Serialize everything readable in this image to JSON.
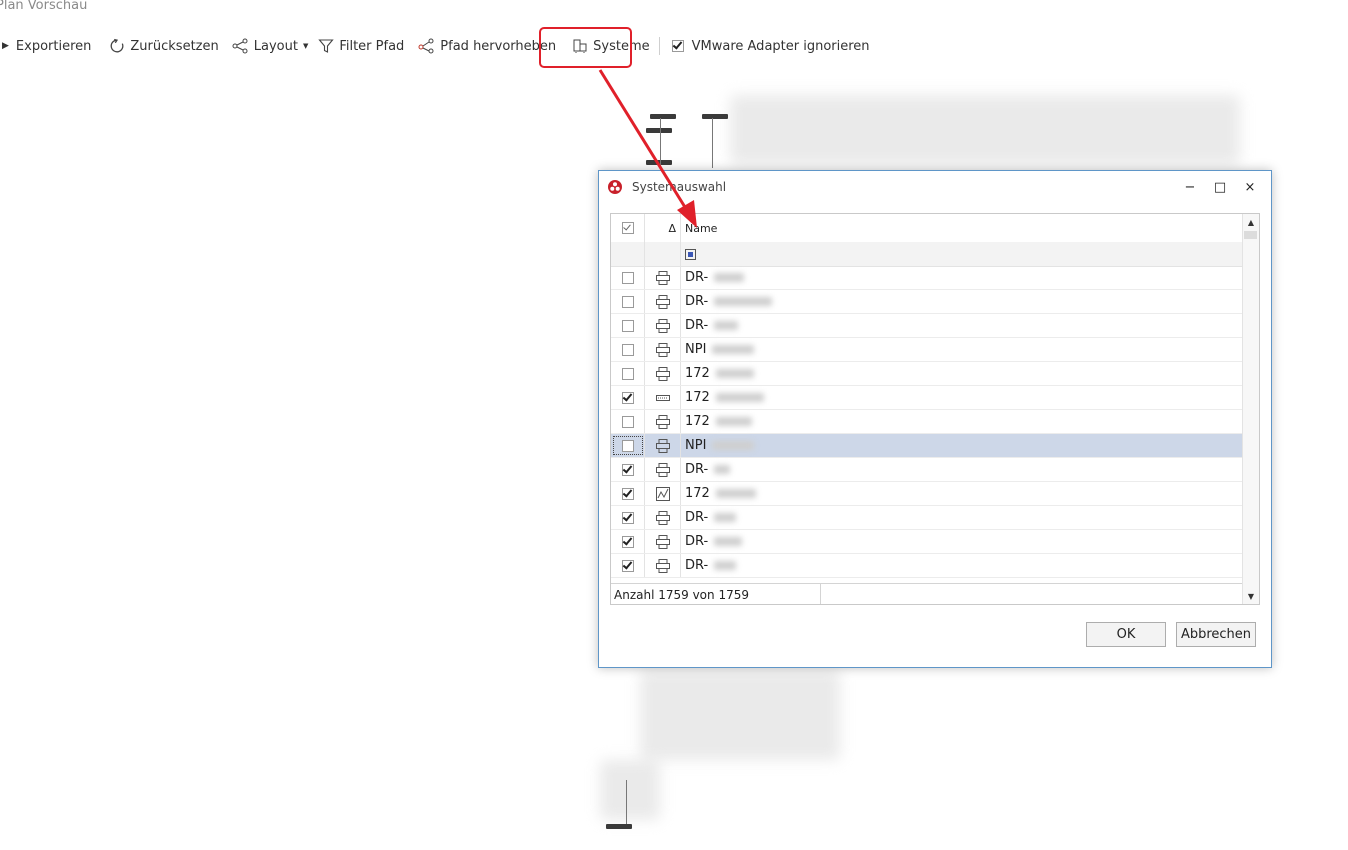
{
  "window": {
    "title": "Plan Vorschau"
  },
  "toolbar": {
    "export": "Exportieren",
    "reset": "Zurücksetzen",
    "layout": "Layout",
    "filter_path": "Filter Pfad",
    "highlight_path": "Pfad hervorheben",
    "systems": "Systeme",
    "ignore_vmware": "VMware Adapter ignorieren",
    "ignore_vmware_checked": true
  },
  "dialog": {
    "title": "Systemauswahl",
    "ctrl_minimize": "−",
    "ctrl_maximize": "□",
    "ctrl_close": "×",
    "grid": {
      "sort_glyph": "Δ",
      "column_name": "Name",
      "rows": [
        {
          "checked": false,
          "icon": "printer-icon",
          "name": "DR-"
        },
        {
          "checked": false,
          "icon": "printer-icon",
          "name": "DR-"
        },
        {
          "checked": false,
          "icon": "printer-icon",
          "name": "DR-"
        },
        {
          "checked": false,
          "icon": "printer-icon",
          "name": "NPI"
        },
        {
          "checked": false,
          "icon": "printer-icon",
          "name": "172"
        },
        {
          "checked": true,
          "icon": "keyboard-icon",
          "name": "172"
        },
        {
          "checked": false,
          "icon": "printer-icon",
          "name": "172"
        },
        {
          "checked": false,
          "icon": "printer-icon",
          "name": "NPI",
          "selected": true
        },
        {
          "checked": true,
          "icon": "printer-icon",
          "name": "DR-"
        },
        {
          "checked": true,
          "icon": "chart-icon",
          "name": "172"
        },
        {
          "checked": true,
          "icon": "printer-icon",
          "name": "DR-"
        },
        {
          "checked": true,
          "icon": "printer-icon",
          "name": "DR-"
        },
        {
          "checked": true,
          "icon": "printer-icon",
          "name": "DR-"
        }
      ],
      "footer_count": "Anzahl 1759 von 1759"
    },
    "ok": "OK",
    "cancel": "Abbrechen"
  },
  "colors": {
    "highlight": "#e0202a",
    "selection": "#cdd7e8"
  }
}
